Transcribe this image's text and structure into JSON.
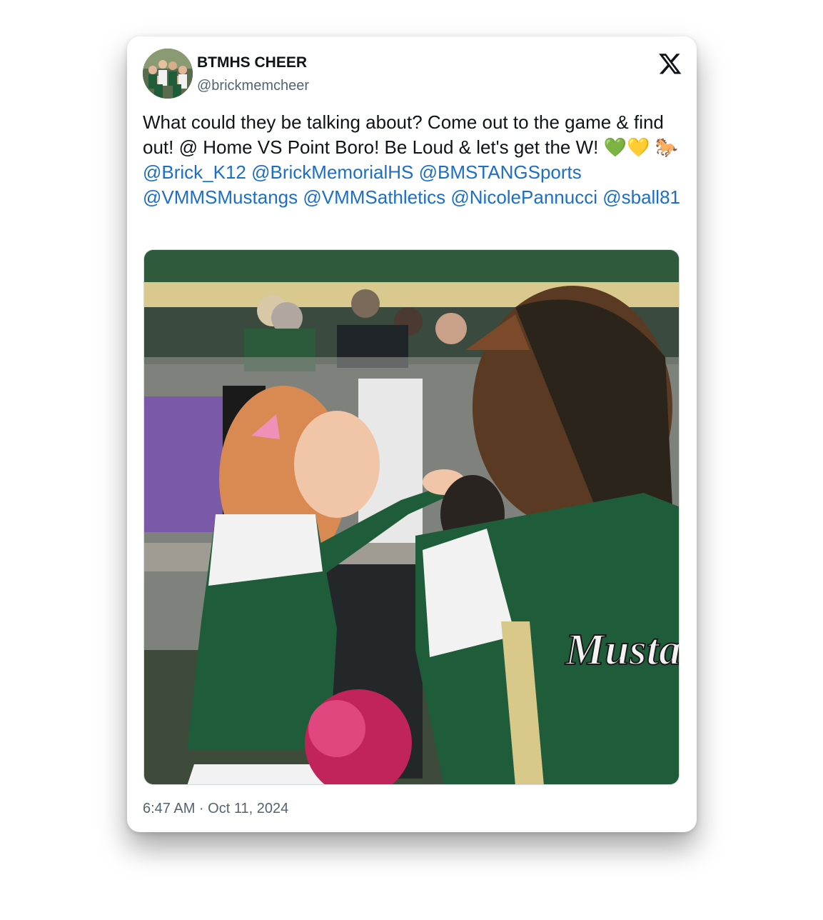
{
  "tweet": {
    "author": {
      "display_name": "BTMHS CHEER",
      "handle": "@brickmemcheer"
    },
    "text_parts": {
      "line_a": "What could they be talking about? Come out to the game & find out! @ Home VS Point Boro! Be Loud & let's get the W!",
      "emoji": "💚💛 🐎",
      "mention_1": "@Brick_K12",
      "mention_2": "@BrickMemorialHS",
      "mention_3": "@BMSTANGSports",
      "mention_4": "@VMMSMustangs",
      "mention_5": "@VMMSathletics",
      "mention_6": "@NicolePannucci",
      "mention_7": "@sball81"
    },
    "jersey_text": "Mustan",
    "timestamp": "6:47 AM · Oct 11, 2024"
  },
  "icons": {
    "platform_logo": "x-logo-icon"
  },
  "colors": {
    "link": "#1b6fc7",
    "text": "#0f1419",
    "muted": "#536471",
    "team_green": "#1f5c3a",
    "team_gold": "#d8c98a"
  }
}
